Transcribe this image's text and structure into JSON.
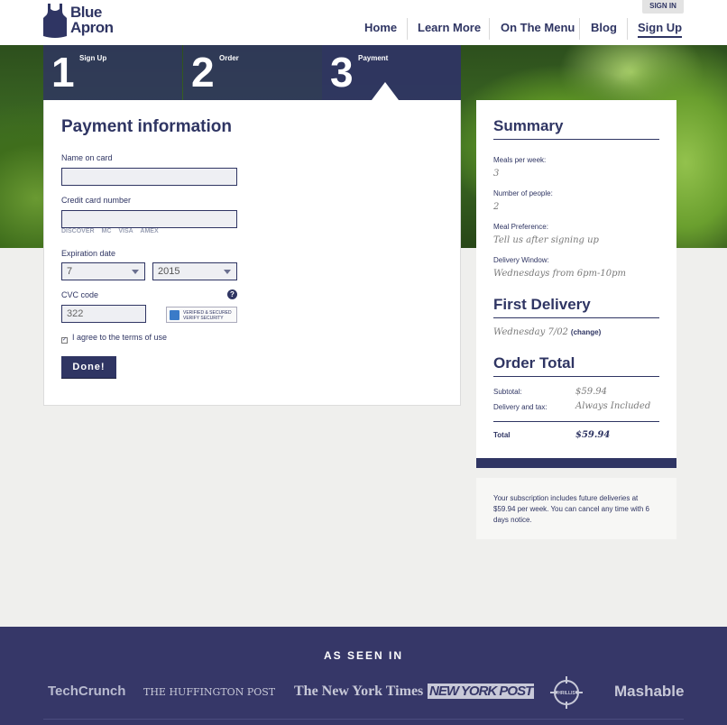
{
  "header": {
    "logo_line1": "Blue",
    "logo_line2": "Apron",
    "sign_in": "SIGN IN",
    "nav": [
      "Home",
      "Learn More",
      "On The Menu",
      "Blog",
      "Sign Up"
    ]
  },
  "steps": [
    {
      "num": "1",
      "label": "Sign Up"
    },
    {
      "num": "2",
      "label": "Order"
    },
    {
      "num": "3",
      "label": "Payment"
    }
  ],
  "payment": {
    "title": "Payment information",
    "name_label": "Name on card",
    "name_value": "",
    "card_label": "Credit card number",
    "card_value": "",
    "card_brands": [
      "DISCOVER",
      "MC",
      "VISA",
      "AMEX"
    ],
    "exp_label": "Expiration date",
    "exp_month": "7",
    "exp_year": "2015",
    "cvc_label": "CVC code",
    "cvc_value": "322",
    "help": "?",
    "verified_text": "VERIFIED & SECURED",
    "verified_sub": "VERIFY SECURITY",
    "agree_text": "I agree to the terms of use",
    "agree_checked": "✓",
    "done_label": "Done!"
  },
  "summary": {
    "title": "Summary",
    "meals_label": "Meals per week:",
    "meals_value": "3",
    "people_label": "Number of people:",
    "people_value": "2",
    "pref_label": "Meal Preference:",
    "pref_value": "Tell us after signing up",
    "window_label": "Delivery Window:",
    "window_value": "Wednesdays from 6pm-10pm",
    "first_title": "First Delivery",
    "first_value": "Wednesday 7/02",
    "change_label": "(change)",
    "total_title": "Order Total",
    "subtotal_label": "Subtotal:",
    "subtotal_value": "$59.94",
    "delivery_label": "Delivery and tax:",
    "delivery_value": "Always Included",
    "total_label": "Total",
    "total_value": "$59.94"
  },
  "note": "Your subscription includes future deliveries at $59.94 per week. You can cancel any time with 6 days notice.",
  "footer": {
    "heading": "AS SEEN IN",
    "press": [
      "TechCrunch",
      "THE HUFFINGTON POST",
      "The New York Times",
      "NEW YORK POST",
      "THRILLIST",
      "Mashable"
    ]
  },
  "colors": {
    "navy": "#2f3563",
    "footer": "#363768"
  }
}
